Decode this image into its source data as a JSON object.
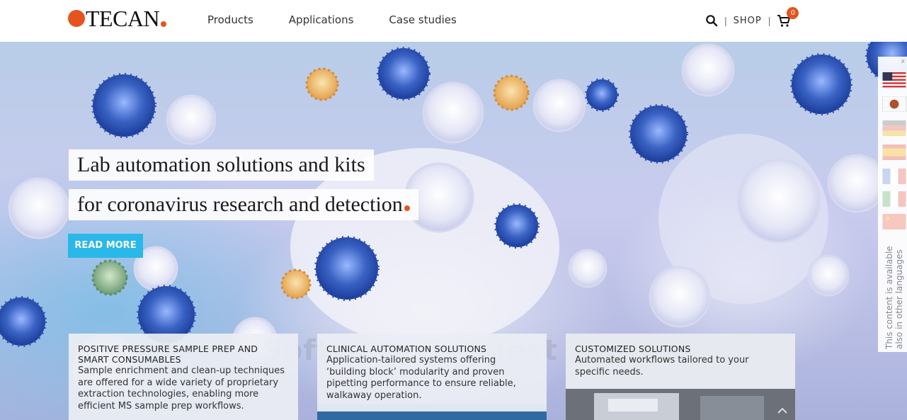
{
  "header": {
    "logo_text": "TECAN",
    "nav": [
      {
        "label": "Products"
      },
      {
        "label": "Applications"
      },
      {
        "label": "Case studies"
      }
    ],
    "sep": "|",
    "shop_label": "SHOP",
    "cart_count": "0",
    "icons": {
      "search": "search-icon",
      "cart": "cart-icon"
    }
  },
  "hero": {
    "headline_line1": "Lab automation solutions and kits",
    "headline_line2": "for coronavirus research and detection",
    "cta_label": "READ MORE"
  },
  "cards": [
    {
      "title": "POSITIVE PRESSURE SAMPLE PREP AND SMART CONSUMABLES",
      "text": "Sample enrichment and clean-up techniques are offered for a wide variety of proprietary extraction technologies, enabling more efficient MS sample prep workflows."
    },
    {
      "title": "CLINICAL AUTOMATION SOLUTIONS",
      "text": "Application-tailored systems offering ‘building block’ modularity and proven pipetting performance to ensure reliable, walkaway operation."
    },
    {
      "title": "CUSTOMIZED SOLUTIONS",
      "text": "Automated workflows tailored to your specific needs."
    }
  ],
  "language_panel": {
    "close_label": "x",
    "note": "This content is available also in other languages"
  },
  "watermark": "Software Suggest",
  "colors": {
    "accent": "#e5541f",
    "cta": "#29b8e8"
  }
}
